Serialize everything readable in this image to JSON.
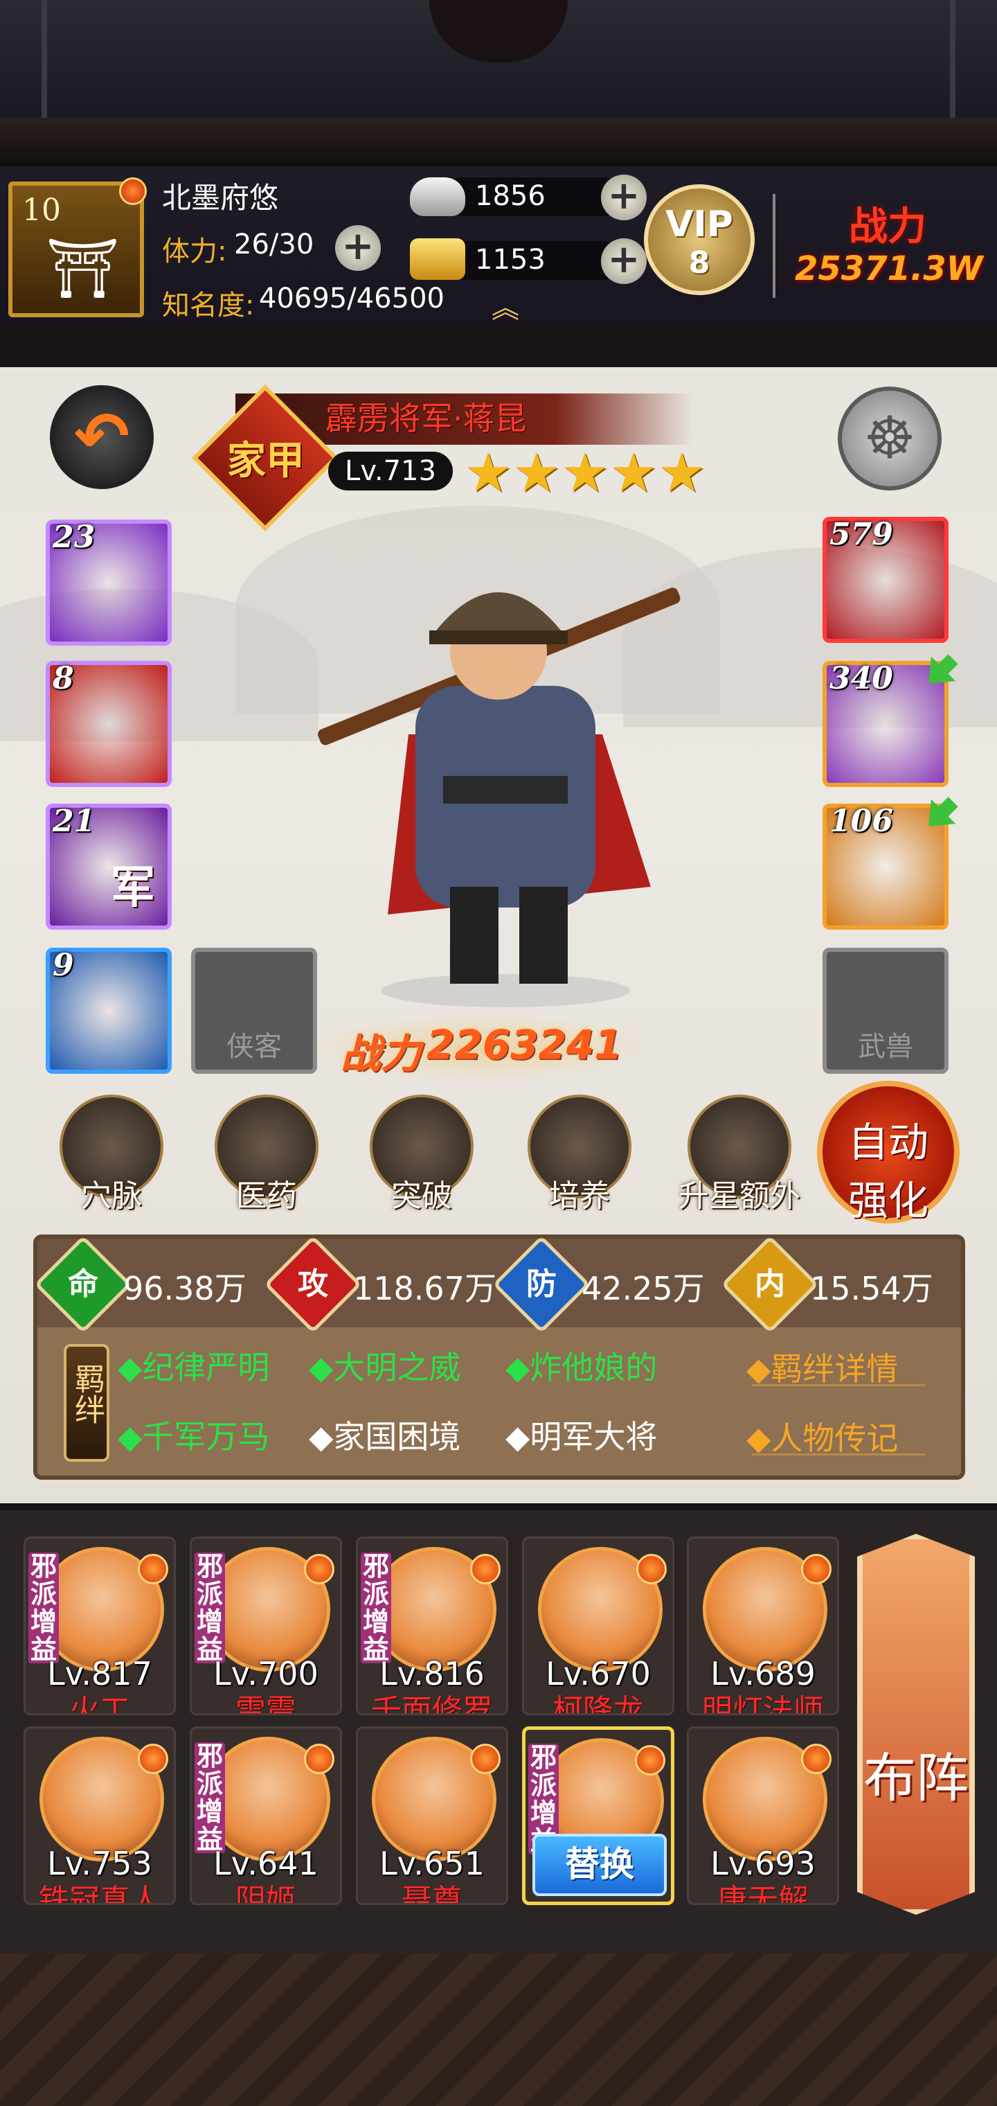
{
  "player": {
    "level": "10",
    "name": "北墨府悠",
    "stamina_label": "体力:",
    "stamina": "26/30",
    "fame_label": "知名度:",
    "fame": "40695/46500",
    "silver": "1856",
    "gold": "1153",
    "vip_label": "VIP",
    "vip_level": "8",
    "power_label": "战力",
    "power": "25371.3W"
  },
  "hero": {
    "title": "霹雳将军·蒋昆",
    "badge": "家甲",
    "level": "Lv.713",
    "stars": 5,
    "power_label": "战力",
    "power": "2263241"
  },
  "left_skills": [
    {
      "count": "23",
      "icon": "crosshair-icon",
      "color": "#7b2cc2"
    },
    {
      "count": "8",
      "icon": "explosion-icon",
      "color": "#c21f1a"
    },
    {
      "count": "21",
      "icon": "army-icon",
      "color": "#6a1d9e",
      "glyph": "军"
    },
    {
      "count": "9",
      "icon": "red-gem-icon",
      "color": "#1e5ab0"
    }
  ],
  "right_gear": [
    {
      "count": "579",
      "icon": "cannon-icon",
      "color": "#b01c24"
    },
    {
      "count": "340",
      "icon": "armor-icon",
      "color": "#8a3ab8"
    },
    {
      "count": "106",
      "icon": "beast-icon",
      "color": "#d57a1a"
    }
  ],
  "empty_slots": {
    "companion": "侠客",
    "beast": "武兽"
  },
  "menu": [
    {
      "label": "穴脉",
      "icon": "meridian-icon"
    },
    {
      "label": "医药",
      "icon": "medicine-icon"
    },
    {
      "label": "突破",
      "icon": "breakthrough-icon"
    },
    {
      "label": "培养",
      "icon": "cultivate-icon"
    },
    {
      "label": "升星额外",
      "icon": "star-upgrade-icon"
    }
  ],
  "auto_button": {
    "line1": "自动",
    "line2": "强化"
  },
  "stats": [
    {
      "glyph": "命",
      "value": "96.38万",
      "color": "#1e9a2a"
    },
    {
      "glyph": "攻",
      "value": "118.67万",
      "color": "#c81d1d"
    },
    {
      "glyph": "防",
      "value": "42.25万",
      "color": "#1f62c2"
    },
    {
      "glyph": "内",
      "value": "15.54万",
      "color": "#d79a12"
    }
  ],
  "bonds": {
    "label": "羁绊",
    "row1": [
      "◆纪律严明",
      "◆大明之威",
      "◆炸他娘的"
    ],
    "row2": [
      "◆千军万马",
      "◆家国困境",
      "◆明军大将"
    ],
    "row2_active": [
      true,
      false,
      false
    ],
    "link1": "◆羁绊详情",
    "link2": "◆人物传记"
  },
  "roster": [
    {
      "level": "Lv.817",
      "name": "火工",
      "tag": "邪派增益"
    },
    {
      "level": "Lv.700",
      "name": "雷震",
      "tag": "邪派增益"
    },
    {
      "level": "Lv.816",
      "name": "千面修罗",
      "tag": "邪派增益"
    },
    {
      "level": "Lv.670",
      "name": "柯降龙",
      "tag": ""
    },
    {
      "level": "Lv.689",
      "name": "明灯法师",
      "tag": ""
    },
    {
      "level": "Lv.753",
      "name": "铁冠真人",
      "tag": ""
    },
    {
      "level": "Lv.641",
      "name": "阴姬",
      "tag": "邪派增益"
    },
    {
      "level": "Lv.651",
      "name": "聂尊",
      "tag": ""
    },
    {
      "level": "",
      "name": "",
      "tag": "邪派增益",
      "replace": "替换"
    },
    {
      "level": "Lv.693",
      "name": "唐无解",
      "tag": ""
    }
  ],
  "formation_button": "布阵"
}
